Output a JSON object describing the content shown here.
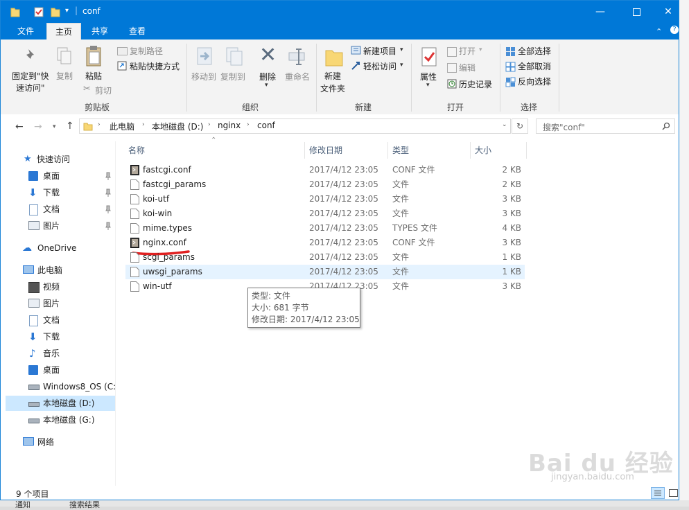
{
  "window": {
    "title": "conf",
    "title_sep": "|"
  },
  "menu": {
    "tabs": [
      {
        "label": "文件"
      },
      {
        "label": "主页"
      },
      {
        "label": "共享"
      },
      {
        "label": "查看"
      }
    ]
  },
  "ribbon": {
    "clipboard": {
      "pin_label_1": "固定到\"快",
      "pin_label_2": "速访问\"",
      "copy_label": "复制",
      "paste_label": "粘贴",
      "copy_path_label": "复制路径",
      "paste_shortcut_label": "粘贴快捷方式",
      "cut_label": "剪切",
      "group_label": "剪贴板"
    },
    "organize": {
      "move_to_label": "移动到",
      "copy_to_label": "复制到",
      "delete_label": "删除",
      "rename_label": "重命名",
      "group_label": "组织"
    },
    "new": {
      "new_folder_label_1": "新建",
      "new_folder_label_2": "文件夹",
      "new_item_label": "新建项目",
      "easy_access_label": "轻松访问",
      "group_label": "新建"
    },
    "open": {
      "properties_label": "属性",
      "open_label": "打开",
      "edit_label": "编辑",
      "history_label": "历史记录",
      "group_label": "打开"
    },
    "select": {
      "select_all_label": "全部选择",
      "select_none_label": "全部取消",
      "invert_label": "反向选择",
      "group_label": "选择"
    }
  },
  "address": {
    "crumbs": [
      "此电脑",
      "本地磁盘 (D:)",
      "nginx",
      "conf"
    ],
    "search_placeholder": "搜索\"conf\""
  },
  "nav": {
    "quick_access": "快速访问",
    "quick_items": [
      {
        "label": "桌面"
      },
      {
        "label": "下载"
      },
      {
        "label": "文档"
      },
      {
        "label": "图片"
      }
    ],
    "onedrive": "OneDrive",
    "this_pc": "此电脑",
    "pc_items": [
      {
        "label": "视频"
      },
      {
        "label": "图片"
      },
      {
        "label": "文档"
      },
      {
        "label": "下载"
      },
      {
        "label": "音乐"
      },
      {
        "label": "桌面"
      },
      {
        "label": "Windows8_OS (C:"
      },
      {
        "label": "本地磁盘 (D:)"
      },
      {
        "label": "本地磁盘 (G:)"
      }
    ],
    "network": "网络"
  },
  "columns": {
    "name": "名称",
    "date": "修改日期",
    "type": "类型",
    "size": "大小"
  },
  "files": [
    {
      "name": "fastcgi.conf",
      "date": "2017/4/12 23:05",
      "type": "CONF 文件",
      "size": "2 KB",
      "icon": "conf-file-icon"
    },
    {
      "name": "fastcgi_params",
      "date": "2017/4/12 23:05",
      "type": "文件",
      "size": "2 KB",
      "icon": "blank-file-icon"
    },
    {
      "name": "koi-utf",
      "date": "2017/4/12 23:05",
      "type": "文件",
      "size": "3 KB",
      "icon": "blank-file-icon"
    },
    {
      "name": "koi-win",
      "date": "2017/4/12 23:05",
      "type": "文件",
      "size": "3 KB",
      "icon": "blank-file-icon"
    },
    {
      "name": "mime.types",
      "date": "2017/4/12 23:05",
      "type": "TYPES 文件",
      "size": "4 KB",
      "icon": "blank-file-icon"
    },
    {
      "name": "nginx.conf",
      "date": "2017/4/12 23:05",
      "type": "CONF 文件",
      "size": "3 KB",
      "icon": "conf-file-icon"
    },
    {
      "name": "scgi_params",
      "date": "2017/4/12 23:05",
      "type": "文件",
      "size": "1 KB",
      "icon": "blank-file-icon"
    },
    {
      "name": "uwsgi_params",
      "date": "2017/4/12 23:05",
      "type": "文件",
      "size": "1 KB",
      "icon": "blank-file-icon"
    },
    {
      "name": "win-utf",
      "date": "2017/4/12 23:05",
      "type": "文件",
      "size": "3 KB",
      "icon": "blank-file-icon"
    }
  ],
  "tooltip": {
    "line1": "类型: 文件",
    "line2": "大小: 681 字节",
    "line3": "修改日期: 2017/4/12 23:05"
  },
  "status": {
    "count": "9 个项目"
  },
  "taskbar_fragment": {
    "left": "通知",
    "right": "搜索结果"
  },
  "watermark": {
    "brand": "Bai du 经验",
    "url": "jingyan.baidu.com"
  },
  "colors": {
    "accent": "#0078d7",
    "hover_row": "#e5f3ff",
    "selected_nav": "#cce8ff",
    "underline_annotation": "#e02020"
  }
}
